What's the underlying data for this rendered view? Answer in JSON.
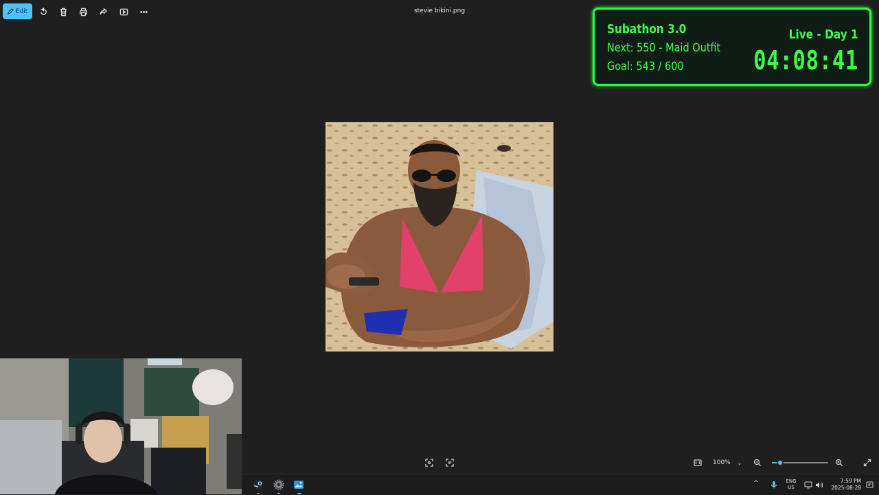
{
  "toolbar": {
    "edit_label": "Edit",
    "file_title": "stevie bikini.png",
    "tools": [
      "rotate-icon",
      "delete-icon",
      "print-icon",
      "share-icon",
      "slideshow-icon",
      "more-icon"
    ]
  },
  "overlay": {
    "title": "Subathon 3.0",
    "next": "Next: 550 - Maid Outfit",
    "goal": "Goal: 543 / 600",
    "live": "Live - Day 1",
    "timer": "04:08:41",
    "accent": "#39ff45"
  },
  "bottombar": {
    "zoom_value": "100%",
    "zoom_chevron": "⌄",
    "zoom_fraction": 0.15
  },
  "taskbar": {
    "lang_top": "ENG",
    "lang_bottom": "US",
    "time": "7:59 PM",
    "date": "2025-08-28",
    "tray_chevron": "^"
  },
  "colors": {
    "accent": "#4cc2ff",
    "background": "#1f1f1f"
  }
}
